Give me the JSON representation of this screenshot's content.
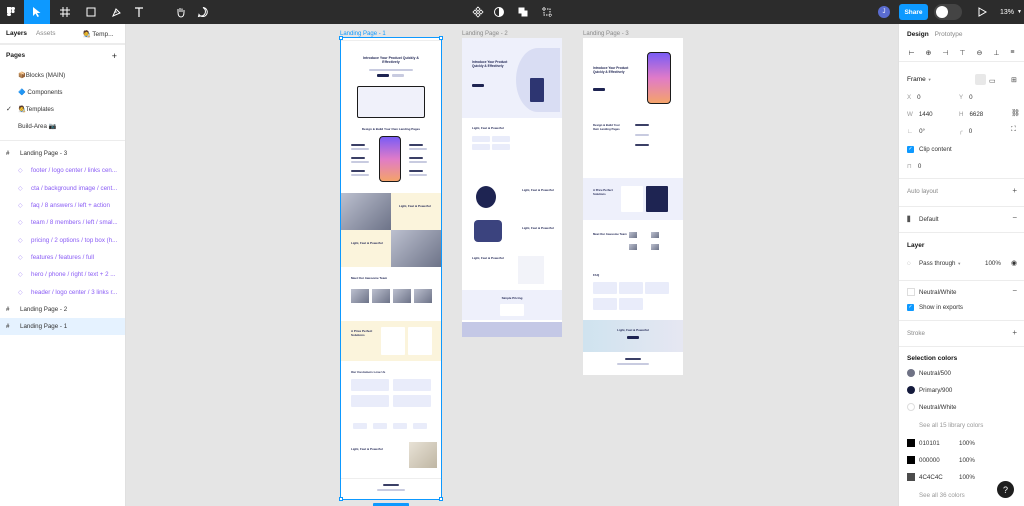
{
  "toolbar": {
    "avatar_initial": "J",
    "share_label": "Share",
    "zoom": "13%"
  },
  "left_panel": {
    "tabs": [
      "Layers",
      "Assets"
    ],
    "project": "🧑‍🎨 Temp...",
    "pages_header": "Pages",
    "pages": [
      {
        "label": "📦Blocks (MAIN)",
        "checked": false
      },
      {
        "label": "🔷 Components",
        "checked": false
      },
      {
        "label": "🧑‍🎨Templates",
        "checked": true
      },
      {
        "label": "Build-Area 📷",
        "checked": false
      }
    ],
    "layers": [
      {
        "label": "Landing Page - 3",
        "type": "frame"
      },
      {
        "label": "footer / logo center / links cen...",
        "type": "child"
      },
      {
        "label": "cta / background image / cent...",
        "type": "child"
      },
      {
        "label": "faq / 8 answers / left + action",
        "type": "child"
      },
      {
        "label": "team / 8 members / left / smal...",
        "type": "child"
      },
      {
        "label": "pricing / 2 options / top box (h...",
        "type": "child"
      },
      {
        "label": "features / features / full",
        "type": "child"
      },
      {
        "label": "hero / phone / right / text + 2 ...",
        "type": "child"
      },
      {
        "label": "header / logo center / 3 links r...",
        "type": "child"
      },
      {
        "label": "Landing Page - 2",
        "type": "frame"
      },
      {
        "label": "Landing Page - 1",
        "type": "frame",
        "selected": true
      }
    ]
  },
  "canvas": {
    "frames": [
      {
        "title": "Landing Page - 1"
      },
      {
        "title": "Landing Page - 2"
      },
      {
        "title": "Landing Page - 3"
      }
    ],
    "lp1": {
      "hero_title": "Introduce Your Product Quickly & Effectively",
      "features_title": "Design & Build Your Own Landing Pages",
      "band1": "Light, Fast & Powerful",
      "band2": "Light, Fast & Powerful",
      "team_title": "Meet Our Awesome Team",
      "pricing_title": "A Price Perfect Solutions",
      "testimonial_title": "Our Customers Love Us",
      "cta_title": "Light, Fast & Powerful"
    },
    "lp2": {
      "hero_title": "Introduce Your Product Quickly & Effectively",
      "feat_title": "Light, Fast & Powerful",
      "sec2": "Light, Fast & Powerful",
      "sec3": "Light, Fast & Powerful",
      "sec4": "Light, Fast & Powerful",
      "pricing": "Simple Pricing"
    },
    "lp3": {
      "hero_title": "Introduce Your Product Quickly & Effectively",
      "features": "Design & Build Your Own Landing Pages",
      "pricing": "A Price Perfect Solutions",
      "team": "Meet Our Awesome Team",
      "faq": "FAQ",
      "cta": "Light, Fast & Powerful"
    }
  },
  "right_panel": {
    "tabs": [
      "Design",
      "Prototype"
    ],
    "frame_label": "Frame",
    "x_label": "X",
    "x_value": "0",
    "y_label": "Y",
    "y_value": "0",
    "w_label": "W",
    "w_value": "1440",
    "h_label": "H",
    "h_value": "6628",
    "rotation": "0°",
    "radius": "0",
    "clip_content": "Clip content",
    "spacing": "0",
    "auto_layout": "Auto layout",
    "default_label": "Default",
    "layer_title": "Layer",
    "blend": "Pass through",
    "opacity": "100%",
    "fill_name": "Neutral/White",
    "show_exports": "Show in exports",
    "stroke": "Stroke",
    "selection_colors": "Selection colors",
    "colors": [
      {
        "name": "Neutral/500",
        "hex": "#6f7285"
      },
      {
        "name": "Primary/900",
        "hex": "#141a3c"
      },
      {
        "name": "Neutral/White",
        "hex": "#ffffff"
      }
    ],
    "see_library": "See all 15 library colors",
    "raw_colors": [
      {
        "hex": "010101",
        "swatch": "#010101",
        "pct": "100%"
      },
      {
        "hex": "000000",
        "swatch": "#000000",
        "pct": "100%"
      },
      {
        "hex": "4C4C4C",
        "swatch": "#4c4c4c",
        "pct": "100%"
      }
    ],
    "see_all": "See all 36 colors"
  },
  "help": "?"
}
